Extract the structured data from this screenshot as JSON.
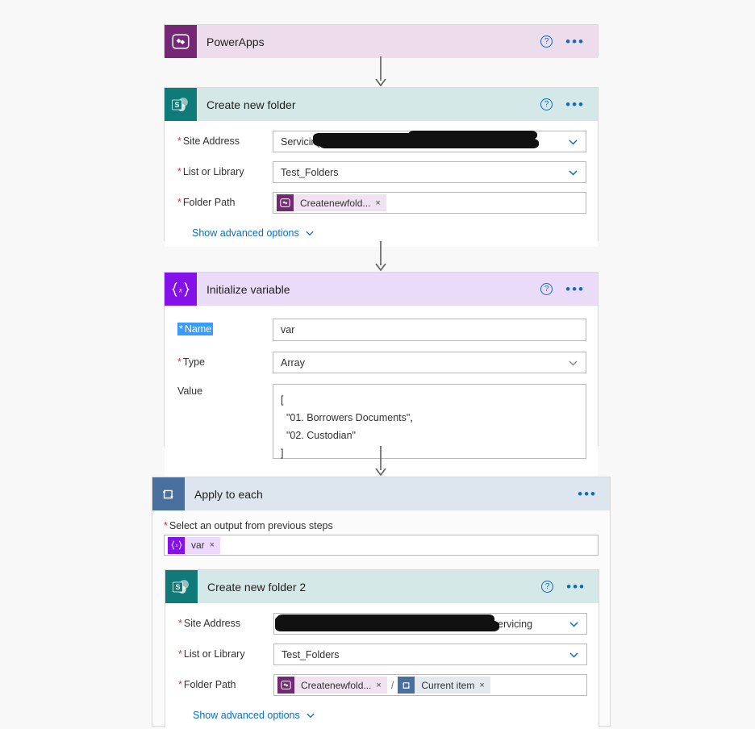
{
  "flow": {
    "steps": [
      {
        "id": "powerapps-trigger",
        "title": "PowerApps",
        "icon": "powerapps-icon",
        "header_bg": "#ecdcec",
        "icon_bg": "#742774",
        "has_help": true,
        "has_menu": true,
        "collapsed": true
      },
      {
        "id": "create-new-folder",
        "title": "Create new folder",
        "icon": "sharepoint-icon",
        "header_bg": "#d5e8e8",
        "icon_bg": "#0f7a78",
        "has_help": true,
        "has_menu": true,
        "fields": [
          {
            "label": "Site Address",
            "required": true,
            "control": "dropdown",
            "value": "Servicing",
            "redacted": true
          },
          {
            "label": "List or Library",
            "required": true,
            "control": "dropdown",
            "value": "Test_Folders",
            "redacted": false
          },
          {
            "label": "Folder Path",
            "required": true,
            "control": "tokens",
            "tokens": [
              {
                "kind": "powerapps",
                "text": "Createnewfold...",
                "close": "×"
              }
            ]
          }
        ],
        "advanced_label": "Show advanced options"
      },
      {
        "id": "initialize-variable",
        "title": "Initialize variable",
        "icon": "variable-icon",
        "header_bg": "#eadcf8",
        "icon_bg": "#8411e8",
        "has_help": true,
        "has_menu": true,
        "fields": [
          {
            "label": "Name",
            "required": true,
            "control": "text",
            "value": "var",
            "selected": true
          },
          {
            "label": "Type",
            "required": true,
            "control": "dropdown",
            "value": "Array"
          },
          {
            "label": "Value",
            "required": false,
            "control": "textarea",
            "value": "[\n  \"01. Borrowers Documents\",\n  \"02. Custodian\"\n]"
          }
        ]
      }
    ],
    "loop": {
      "id": "apply-to-each",
      "title": "Apply to each",
      "icon": "loop-icon",
      "header_bg": "#dde5ee",
      "icon_bg": "#486f9e",
      "has_help": false,
      "has_menu": true,
      "input_label": "Select an output from previous steps",
      "input_required": true,
      "input_tokens": [
        {
          "kind": "variable",
          "text": "var",
          "close": "×"
        }
      ],
      "child": {
        "id": "create-new-folder-2",
        "title": "Create new folder 2",
        "icon": "sharepoint-icon",
        "header_bg": "#d5e8e8",
        "icon_bg": "#0f7a78",
        "has_help": true,
        "has_menu": true,
        "fields": [
          {
            "label": "Site Address",
            "required": true,
            "control": "dropdown",
            "value": "ervicing",
            "redacted": true
          },
          {
            "label": "List or Library",
            "required": true,
            "control": "dropdown",
            "value": "Test_Folders",
            "redacted": false
          },
          {
            "label": "Folder Path",
            "required": true,
            "control": "tokens",
            "tokens": [
              {
                "kind": "powerapps",
                "text": "Createnewfold...",
                "close": "×"
              },
              {
                "kind": "separator",
                "text": "/"
              },
              {
                "kind": "loop",
                "text": "Current item",
                "close": "×"
              }
            ]
          }
        ],
        "advanced_label": "Show advanced options"
      }
    },
    "icons": {
      "help": "?",
      "menu": "•••",
      "chevron_down": "chevron-down-icon",
      "arrow_down": "arrow-down-icon"
    },
    "colors": {
      "page_bg": "#f8f8f8",
      "link": "#0f6cbd",
      "required": "#d13438",
      "selection": "#3a9bfc",
      "border": "#d8d8d8"
    }
  }
}
